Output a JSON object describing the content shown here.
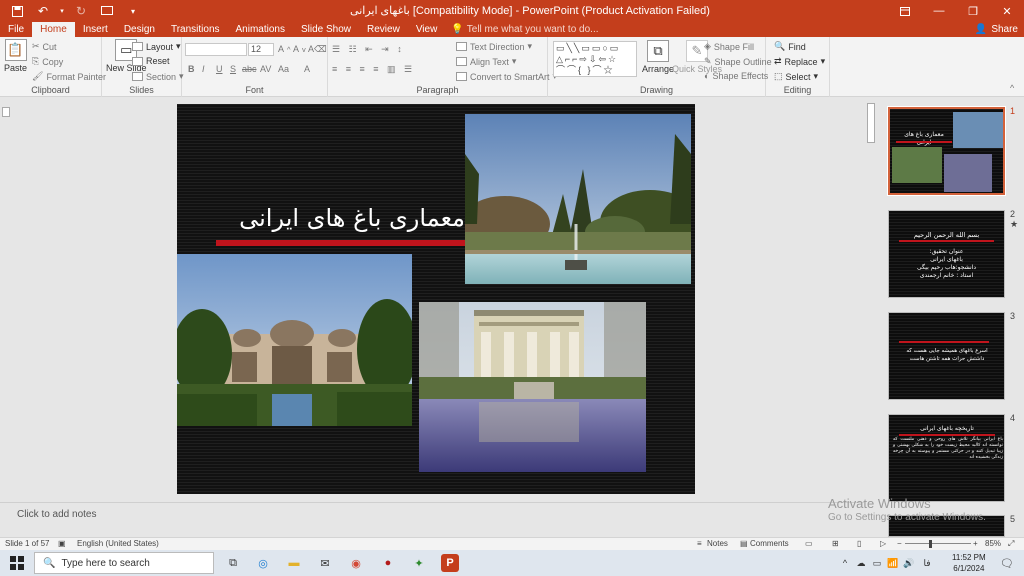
{
  "window": {
    "title": "باغهای ایرانی [Compatibility Mode] - PowerPoint (Product Activation Failed)"
  },
  "tabs": [
    "File",
    "Home",
    "Insert",
    "Design",
    "Transitions",
    "Animations",
    "Slide Show",
    "Review",
    "View"
  ],
  "active_tab": "Home",
  "tell_me": "Tell me what you want to do...",
  "share_label": "Share",
  "ribbon": {
    "clipboard": {
      "paste": "Paste",
      "cut": "Cut",
      "copy": "Copy",
      "format_painter": "Format Painter",
      "label": "Clipboard"
    },
    "slides": {
      "new_slide": "New Slide",
      "layout": "Layout",
      "reset": "Reset",
      "section": "Section",
      "label": "Slides"
    },
    "font": {
      "size": "12",
      "label": "Font",
      "buttons": [
        "B",
        "I",
        "U",
        "S",
        "abc",
        "AV",
        "Aa",
        "A"
      ]
    },
    "paragraph": {
      "text_direction": "Text Direction",
      "align_text": "Align Text",
      "convert_smartart": "Convert to SmartArt",
      "label": "Paragraph"
    },
    "drawing": {
      "arrange": "Arrange",
      "quick_styles": "Quick Styles",
      "shape_fill": "Shape Fill",
      "shape_outline": "Shape Outline",
      "shape_effects": "Shape Effects",
      "label": "Drawing"
    },
    "editing": {
      "find": "Find",
      "replace": "Replace",
      "select": "Select",
      "label": "Editing"
    }
  },
  "slide": {
    "title": "معماری باغ های ایرانی"
  },
  "thumbnails": [
    {
      "number": "1",
      "title": "معماری باغ های ایرانی"
    },
    {
      "number": "2",
      "lines": [
        "بسم الله الرحمن الرحیم",
        "عنوان تحقیق:",
        "باغهای ایرانی",
        "دانشجو:هاب رحیم بیگی",
        "استاد : خانم ارجمندی"
      ]
    },
    {
      "number": "3",
      "lines": [
        "اسرع باغهای همیشه جایی هست که",
        "داشتش حرات همه تاشتن هاست"
      ]
    },
    {
      "number": "4",
      "title": "تاریخچه باغهای ایرانی",
      "body": "باغ ایرانی بیانگر تلاش های روحی و ذهنی ملتست که توانسته اند کالبد محیط زیست خود را به شکلی بهشتی و زیبا تبدیل کنند و در حرکتی مستمر و پیوسته به آن چرخه زندگی بخشیده اند"
    },
    {
      "number": "5"
    }
  ],
  "notes_placeholder": "Click to add notes",
  "watermark": {
    "line1": "Activate Windows",
    "line2": "Go to Settings to activate Windows."
  },
  "status": {
    "slide_of": "Slide 1 of 57",
    "language": "English (United States)",
    "notes": "Notes",
    "comments": "Comments",
    "zoom": "85%"
  },
  "taskbar": {
    "search_placeholder": "Type here to search",
    "time": "11:52 PM",
    "date": "6/1/2024",
    "lang": "فا"
  },
  "colors": {
    "accent": "#c43e1c",
    "slide_red": "#c0141c"
  }
}
